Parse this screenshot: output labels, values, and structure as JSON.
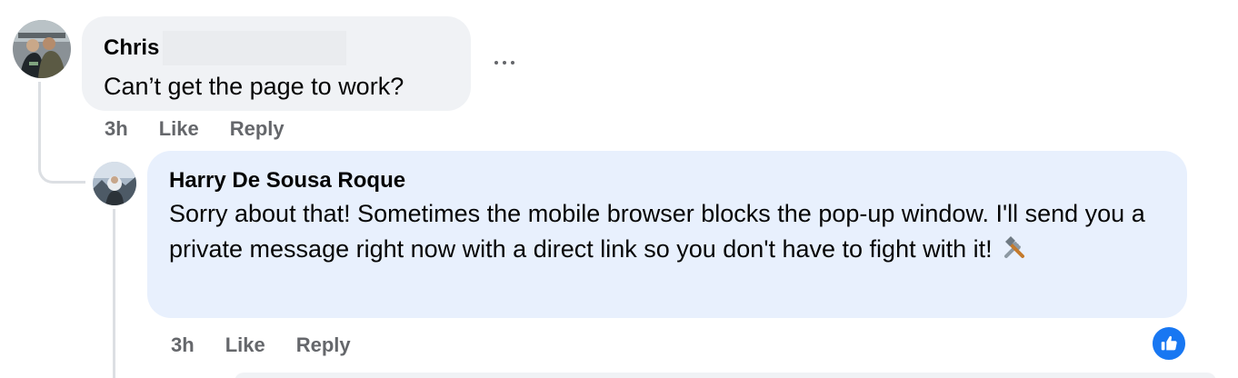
{
  "comment": {
    "author": "Chris",
    "text": "Can’t get the page to work?",
    "time": "3h",
    "like_label": "Like",
    "reply_label": "Reply",
    "more_icon": "more-horizontal-icon"
  },
  "reply": {
    "author": "Harry De Sousa Roque",
    "text": "Sorry about that! Sometimes the mobile browser blocks the pop-up window. I'll send you a private message right now with a direct link so you don't have to fight with it!",
    "emoji": "hammer-and-wrench-icon",
    "time": "3h",
    "like_label": "Like",
    "reply_label": "Reply",
    "reaction": "thumbs-up-icon"
  },
  "colors": {
    "bubble_grey": "#f0f2f5",
    "bubble_blue": "#e8f0fd",
    "meta_text": "#65676b",
    "like_blue": "#1877f2",
    "thread_line": "#dcdfe3"
  }
}
